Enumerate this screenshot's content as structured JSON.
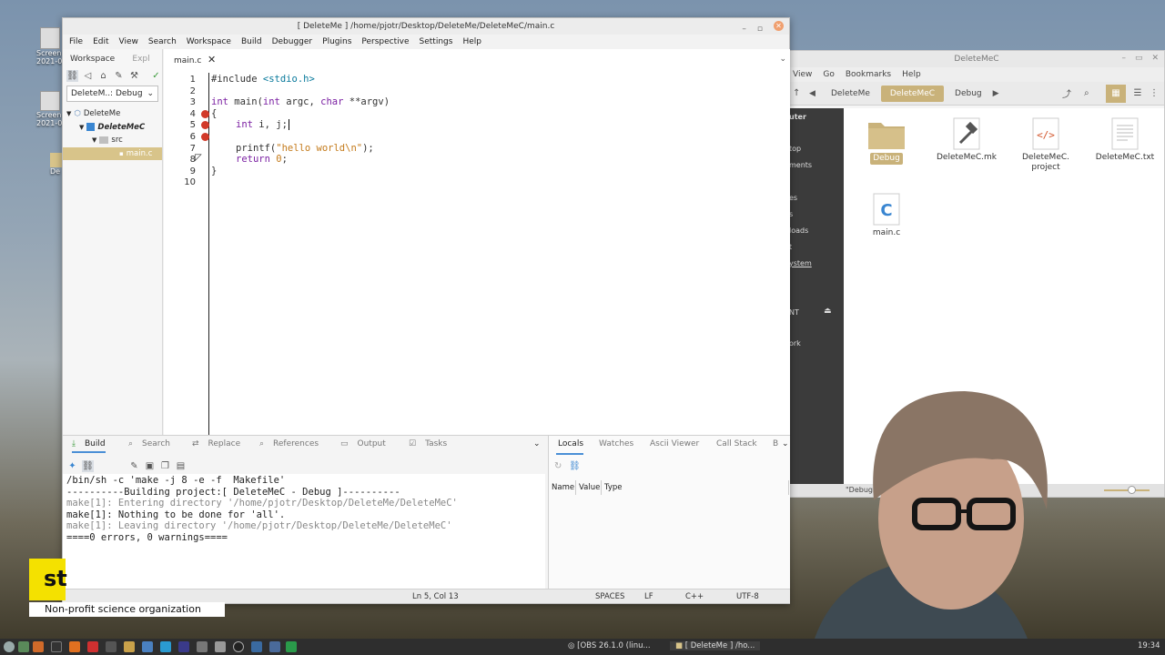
{
  "desktop": {
    "icons": [
      {
        "label": "Screen",
        "sublabel": "2021-0"
      },
      {
        "label": "Screen",
        "sublabel": "2021-0"
      },
      {
        "label": "De"
      }
    ]
  },
  "ide": {
    "title": "[ DeleteMe ] /home/pjotr/Desktop/DeleteMe/DeleteMeC/main.c",
    "menu": [
      "File",
      "Edit",
      "View",
      "Search",
      "Workspace",
      "Build",
      "Debugger",
      "Plugins",
      "Perspective",
      "Settings",
      "Help"
    ],
    "left_tabs": {
      "workspace": "Workspace",
      "explorer": "Expl"
    },
    "config_combo": "DeleteM..: Debug",
    "tree": {
      "workspace": "DeleteMe",
      "project": "DeleteMeC",
      "folder": "src",
      "file": "main.c"
    },
    "editor_tab": "main.c",
    "code": {
      "line_numbers": [
        "1",
        "2",
        "3",
        "4",
        "5",
        "6",
        "7",
        "8",
        "9",
        "10"
      ],
      "l1_kw": "#include",
      "l1_rest": " <stdio.h>",
      "l3_a": "int",
      "l3_b": " main(",
      "l3_c": "int",
      "l3_d": " argc, ",
      "l3_e": "char",
      "l3_f": " **argv)",
      "l4": "{",
      "l5_kw": "int",
      "l5_rest": " i, j;",
      "l7_a": "printf(",
      "l7_str": "\"hello world\\n\"",
      "l7_end": ");",
      "l8_kw": "return",
      "l8_num": " 0",
      "l8_end": ";",
      "l9": "}"
    },
    "bottom_tabs": [
      "Build",
      "Search",
      "Replace",
      "References",
      "Output",
      "Tasks"
    ],
    "build_output": [
      "/bin/sh -c 'make -j 8 -e -f  Makefile'",
      "----------Building project:[ DeleteMeC - Debug ]----------",
      "make[1]: Entering directory '/home/pjotr/Desktop/DeleteMe/DeleteMeC'",
      "make[1]: Nothing to be done for 'all'.",
      "make[1]: Leaving directory '/home/pjotr/Desktop/DeleteMe/DeleteMeC'",
      "====0 errors, 0 warnings===="
    ],
    "debug_tabs": [
      "Locals",
      "Watches",
      "Ascii Viewer",
      "Call Stack",
      "B"
    ],
    "locals_columns": [
      "Name",
      "Value",
      "Type"
    ],
    "status": {
      "position": "Ln 5, Col 13",
      "indent": "SPACES",
      "eol": "LF",
      "lang": "C++",
      "encoding": "UTF-8"
    }
  },
  "file_manager": {
    "title": "DeleteMeC",
    "menu": [
      "View",
      "Go",
      "Bookmarks",
      "Help"
    ],
    "breadcrumbs": [
      "DeleteMe",
      "DeleteMeC",
      "Debug"
    ],
    "sidebar": [
      "uter",
      "top",
      "ments",
      "es",
      "s",
      "loads",
      "t",
      "ystem",
      "NT",
      "ork"
    ],
    "files": [
      {
        "name": "Debug",
        "type": "folder"
      },
      {
        "name": "DeleteMeC.mk",
        "type": "make"
      },
      {
        "name": "DeleteMeC.",
        "name2": "project",
        "type": "xml"
      },
      {
        "name": "DeleteMeC.txt",
        "type": "text"
      },
      {
        "name": "main.c",
        "type": "c-source"
      }
    ],
    "status": "\"Debug\" sel"
  },
  "overlay": {
    "banner_text": "Non-profit science organization",
    "banner_logo": "st"
  },
  "taskbar": {
    "tasks": [
      "[OBS 26.1.0 (linu...",
      "[ DeleteMe ] /ho..."
    ],
    "clock": "19:34"
  },
  "colors": {
    "accent": "#4a8fd6",
    "breakpoint": "#d23a2a",
    "folder": "#c9b27a",
    "keyword": "#7a1fa2"
  }
}
